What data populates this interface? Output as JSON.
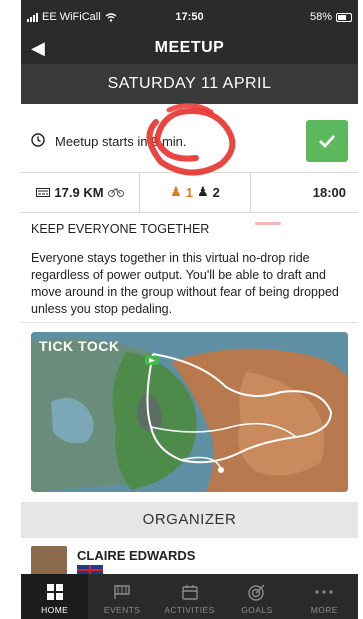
{
  "status_bar": {
    "carrier": "EE WiFiCall",
    "time": "17:50",
    "battery": "58%"
  },
  "nav": {
    "back_icon": "chevron-left-icon",
    "title": "MEETUP"
  },
  "date": "SATURDAY 11 APRIL",
  "meetup_start": {
    "text": "Meetup starts in 9 min.",
    "join_icon": "checkmark-icon"
  },
  "stats": {
    "distance": "17.9 KM",
    "groups_a": "1",
    "groups_b": "2",
    "start_time": "18:00"
  },
  "description": {
    "heading": "KEEP EVERYONE TOGETHER",
    "body": "Everyone stays together in this virtual no-drop ride regardless of power output. You'll be able to draft and move around in the group without fear of being dropped unless you stop pedaling."
  },
  "route": {
    "name": "TICK TOCK"
  },
  "organizer": {
    "section_label": "ORGANIZER",
    "name": "CLAIRE EDWARDS"
  },
  "tabs": [
    {
      "label": "HOME",
      "icon": "home-grid-icon",
      "active": true
    },
    {
      "label": "EVENTS",
      "icon": "events-flag-icon",
      "active": false
    },
    {
      "label": "ACTIVITIES",
      "icon": "calendar-icon",
      "active": false
    },
    {
      "label": "GOALS",
      "icon": "target-icon",
      "active": false
    },
    {
      "label": "MORE",
      "icon": "more-dots-icon",
      "active": false
    }
  ],
  "colors": {
    "header_bg": "#2b2b2b",
    "date_bg": "#3a3a3a",
    "join_green": "#5cb85c",
    "annotation_red": "#e8322c",
    "group_orange": "#e07a1f"
  }
}
